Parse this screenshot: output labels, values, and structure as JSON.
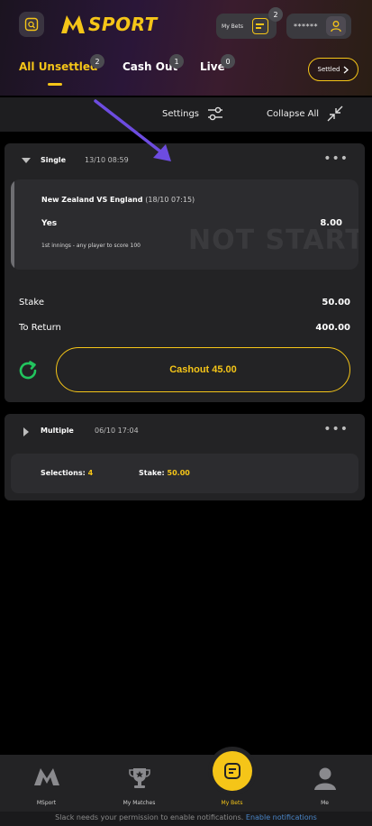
{
  "header": {
    "logo_text": "SPORT",
    "my_bets_label": "My Bets",
    "my_bets_count": "2",
    "account_mask": "******"
  },
  "tabs": [
    {
      "label": "All Unsettled",
      "count": "2"
    },
    {
      "label": "Cash Out",
      "count": "1"
    },
    {
      "label": "Live",
      "count": "0"
    }
  ],
  "settled_label": "Settled",
  "toolbar": {
    "settings_label": "Settings",
    "collapse_label": "Collapse All"
  },
  "bets": {
    "single": {
      "type": "Single",
      "time": "13/10 08:59",
      "match": "New Zealand VS England",
      "match_time": "(18/10 07:15)",
      "pick": "Yes",
      "odds": "8.00",
      "market": "1st innings - any player to score 100",
      "status_watermark": "NOT START",
      "stake_label": "Stake",
      "stake_value": "50.00",
      "return_label": "To Return",
      "return_value": "400.00",
      "cashout_label": "Cashout 45.00"
    },
    "multiple": {
      "type": "Multiple",
      "time": "06/10 17:04",
      "selections_label": "Selections:",
      "selections_value": "4",
      "stake_label": "Stake:",
      "stake_value": "50.00"
    }
  },
  "bottom_nav": [
    {
      "label": "MSport",
      "icon": "msport-logo-icon"
    },
    {
      "label": "My Matches",
      "icon": "trophy-icon"
    },
    {
      "label": "My Bets",
      "icon": "betslip-icon"
    },
    {
      "label": "Me",
      "icon": "user-icon"
    }
  ],
  "notification": {
    "text": "Slack needs your permission to enable notifications.",
    "link": "Enable notifications"
  },
  "colors": {
    "accent": "#f5c518",
    "refresh": "#22c55e",
    "annotation_arrow": "#6d4ce0"
  }
}
